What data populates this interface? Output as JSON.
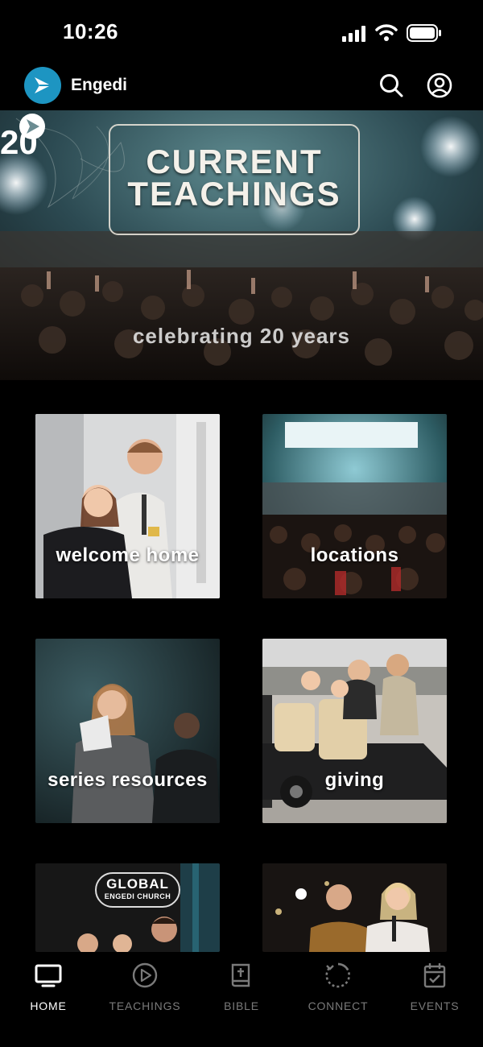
{
  "status_bar": {
    "time": "10:26"
  },
  "header": {
    "app_name": "Engedi"
  },
  "hero": {
    "title": "CURRENT\nTEACHINGS",
    "subtitle": "celebrating 20 years",
    "badge": "20"
  },
  "tiles": [
    {
      "label": "welcome home"
    },
    {
      "label": "locations"
    },
    {
      "label": "series resources"
    },
    {
      "label": "giving"
    },
    {
      "label": "",
      "sign_line1": "GLOBAL",
      "sign_line2": "ENGEDI CHURCH"
    },
    {
      "label": ""
    }
  ],
  "tabs": [
    {
      "label": "HOME",
      "icon": "tv-icon",
      "active": true
    },
    {
      "label": "TEACHINGS",
      "icon": "play-circle-icon",
      "active": false
    },
    {
      "label": "BIBLE",
      "icon": "bible-icon",
      "active": false
    },
    {
      "label": "CONNECT",
      "icon": "connect-refresh-icon",
      "active": false
    },
    {
      "label": "EVENTS",
      "icon": "calendar-check-icon",
      "active": false
    }
  ],
  "colors": {
    "brand": "#1d95c2",
    "background": "#000000",
    "tab_inactive": "#7a7a7a"
  }
}
